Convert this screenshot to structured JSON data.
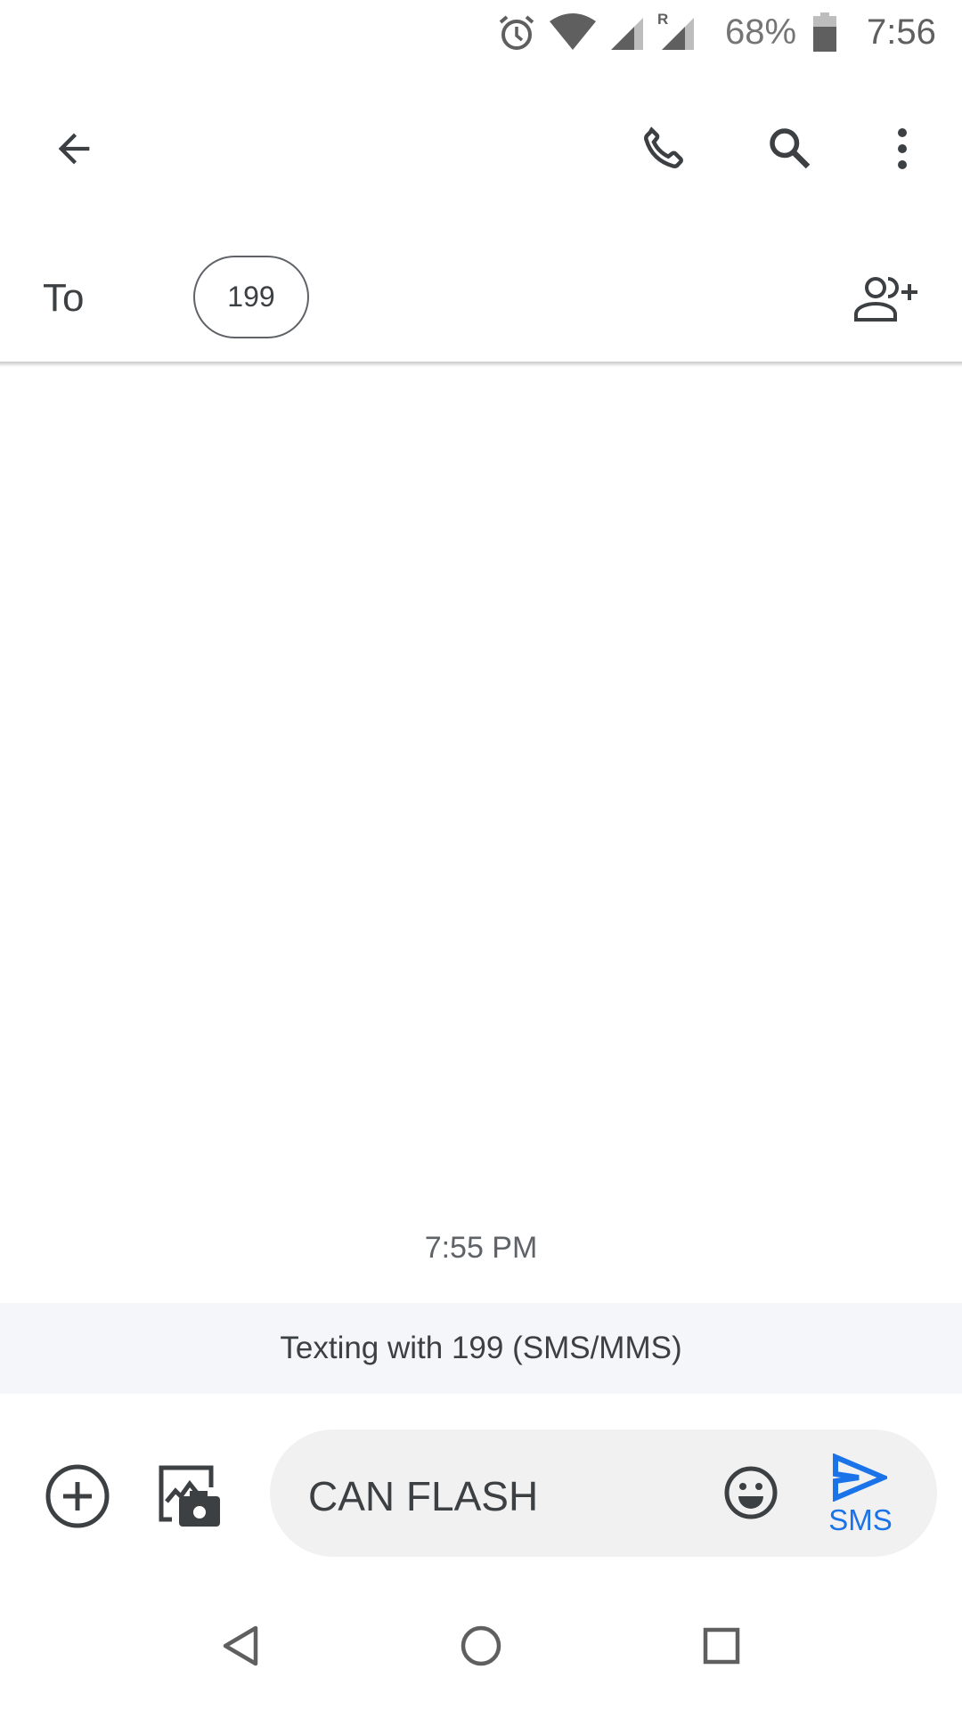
{
  "status_bar": {
    "battery_percent": "68%",
    "time": "7:56",
    "icons": [
      "alarm-icon",
      "wifi-icon",
      "signal-icon",
      "roaming-signal-icon",
      "battery-icon"
    ],
    "roaming_label": "R"
  },
  "toolbar": {
    "icons": [
      "back-arrow-icon",
      "phone-icon",
      "search-icon",
      "more-vert-icon"
    ]
  },
  "recipient": {
    "to_label": "To",
    "chip": "199"
  },
  "conversation": {
    "timestamp": "7:55 PM",
    "banner": "Texting with 199 (SMS/MMS)"
  },
  "compose": {
    "value": "CAN FLASH",
    "send_label": "SMS",
    "accent": "#1a73e8"
  },
  "nav": {
    "icons": [
      "nav-back-icon",
      "nav-home-icon",
      "nav-recents-icon"
    ]
  }
}
